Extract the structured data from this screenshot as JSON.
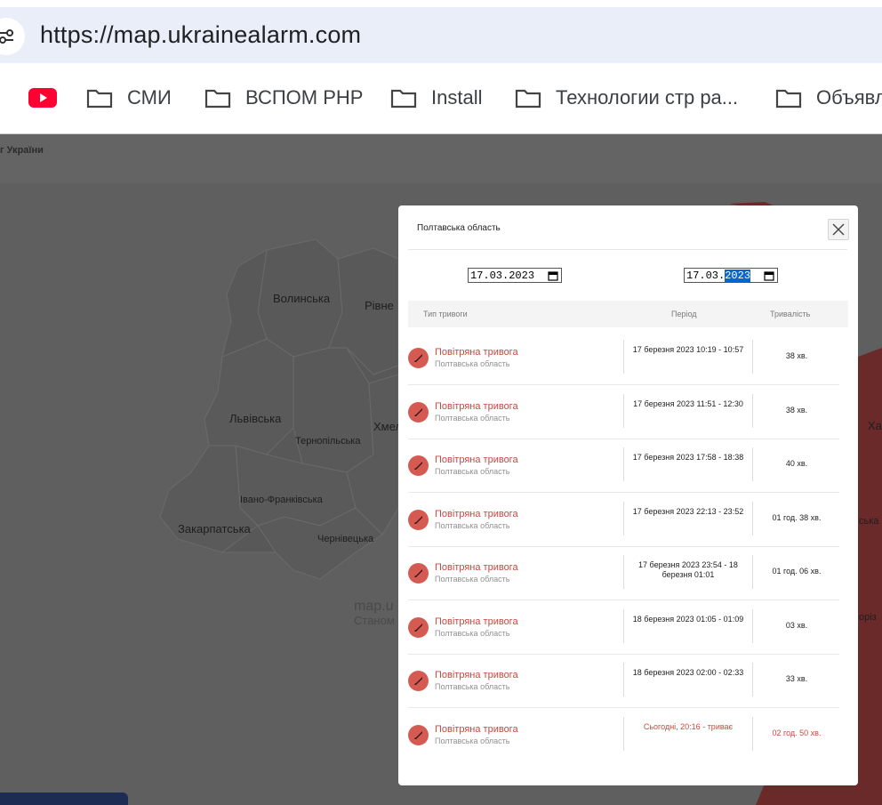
{
  "browser": {
    "url": "https://map.ukrainealarm.com",
    "bookmarks": [
      {
        "label": "",
        "icon": "youtube-icon"
      },
      {
        "label": "СМИ",
        "icon": "folder-icon"
      },
      {
        "label": "ВСПОМ PHP",
        "icon": "folder-icon"
      },
      {
        "label": "Install",
        "icon": "folder-icon"
      },
      {
        "label": "Технологии стр ра...",
        "icon": "folder-icon"
      },
      {
        "label": "Объявл",
        "icon": "folder-icon"
      }
    ]
  },
  "map": {
    "header_text": "г України",
    "regions": [
      "Волинська",
      "Рівне",
      "Львівська",
      "Хмел",
      "Тернопільська",
      "Івано-Франківська",
      "Закарпатська",
      "Чернівецька",
      "Ха",
      "ська",
      "оріз"
    ],
    "watermark_line1": "map.u",
    "watermark_line2": "Станом"
  },
  "modal": {
    "title": "Полтавська область",
    "date_from": {
      "day_month": "17.03.",
      "year": "2023"
    },
    "date_to": {
      "day_month": "17.03.",
      "year": "2023"
    },
    "columns": {
      "type": "Тип тривоги",
      "period": "Період",
      "duration": "Тривалість"
    },
    "rows": [
      {
        "type": "Повітряна тривога",
        "region": "Полтавська область",
        "period": "17 березня 2023 10:19 - 10:57",
        "duration": "38 хв."
      },
      {
        "type": "Повітряна тривога",
        "region": "Полтавська область",
        "period": "17 березня 2023 11:51 - 12:30",
        "duration": "38 хв."
      },
      {
        "type": "Повітряна тривога",
        "region": "Полтавська область",
        "period": "17 березня 2023 17:58 - 18:38",
        "duration": "40 хв."
      },
      {
        "type": "Повітряна тривога",
        "region": "Полтавська область",
        "period": "17 березня 2023 22:13 - 23:52",
        "duration": "01 год. 38 хв."
      },
      {
        "type": "Повітряна тривога",
        "region": "Полтавська область",
        "period": "17 березня 2023 23:54 - 18 березня 01:01",
        "duration": "01 год. 06 хв."
      },
      {
        "type": "Повітряна тривога",
        "region": "Полтавська область",
        "period": "18 березня 2023 01:05 - 01:09",
        "duration": "03 хв."
      },
      {
        "type": "Повітряна тривога",
        "region": "Полтавська область",
        "period": "18 березня 2023 02:00 - 02:33",
        "duration": "33 хв."
      },
      {
        "type": "Повітряна тривога",
        "region": "Полтавська область",
        "period": "Сьогодні, 20:16 - триває",
        "duration": "02 год. 50 хв."
      }
    ]
  },
  "colors": {
    "alarm_red": "#c9473f",
    "alert_region": "#6b2a2a",
    "map_bg": "#5f5f5f"
  }
}
